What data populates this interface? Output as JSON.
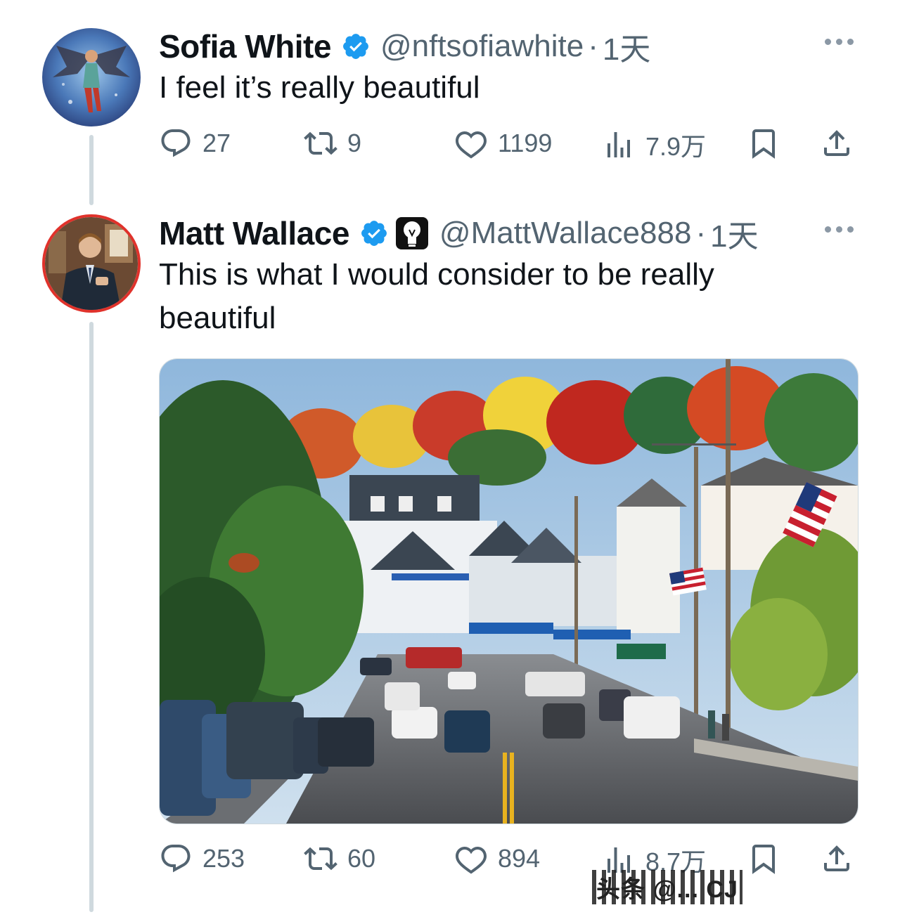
{
  "tweets": [
    {
      "name": "Sofia White",
      "handle": "@nftsofiawhite",
      "separator": "·",
      "time": "1天",
      "text": "I feel it’s really beautiful",
      "stats": {
        "replies": "27",
        "reposts": "9",
        "likes": "1199",
        "views": "7.9万"
      },
      "avatar_icon": "angel-avatar"
    },
    {
      "name": "Matt Wallace",
      "handle": "@MattWallace888",
      "separator": "·",
      "time": "1天",
      "text": "This is what I would consider to be really beautiful",
      "stats": {
        "replies": "253",
        "reposts": "60",
        "likes": "894",
        "views": "8.7万"
      },
      "avatar_icon": "man-in-suit-avatar",
      "badge_icon": "lightbulb-emoji-icon"
    }
  ],
  "colors": {
    "text": "#0f1419",
    "muted": "#536471",
    "verified": "#1d9bf0",
    "thread": "#cfd9de",
    "avatar_ring": "#e0322b"
  },
  "watermark": "头条 @... CJ"
}
